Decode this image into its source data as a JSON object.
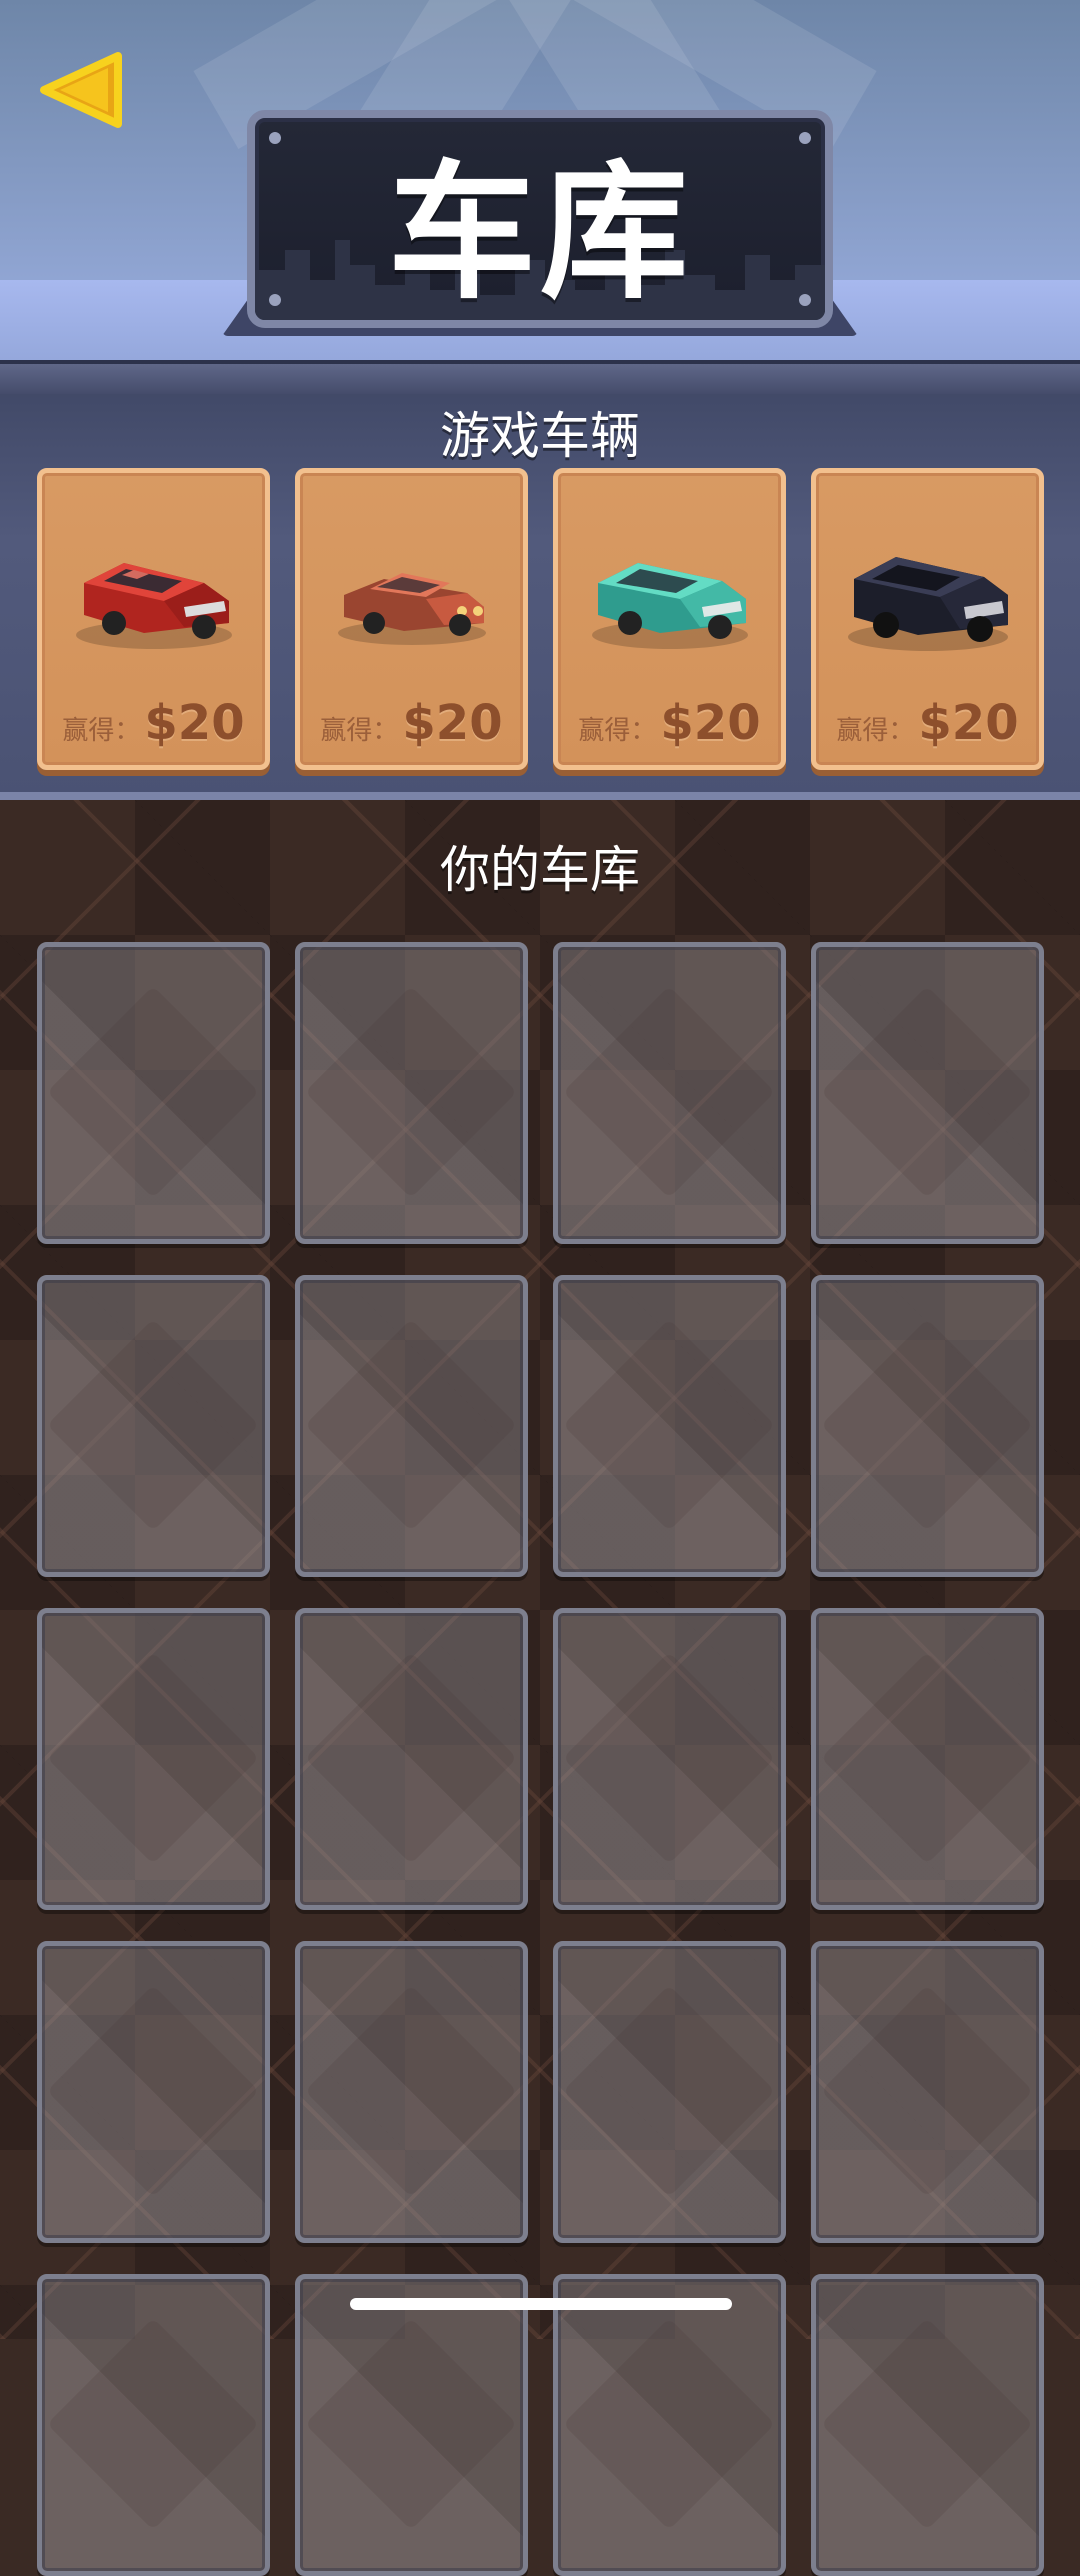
{
  "header": {
    "title": "车库",
    "back_icon": "back-triangle-icon",
    "accent_color": "#f7c21a"
  },
  "game_vehicles": {
    "title": "游戏车辆",
    "cars": [
      {
        "name": "red-suv",
        "color": "#d8352c",
        "price_label": "赢得：",
        "price": "$20"
      },
      {
        "name": "orange-sedan",
        "color": "#d96b4d",
        "price_label": "赢得：",
        "price": "$20"
      },
      {
        "name": "teal-suv",
        "color": "#53d1b9",
        "price_label": "赢得：",
        "price": "$20"
      },
      {
        "name": "black-suv",
        "color": "#2a2c3c",
        "price_label": "赢得：",
        "price": "$20"
      }
    ]
  },
  "garage": {
    "title": "你的车库",
    "slot_count": 20
  }
}
